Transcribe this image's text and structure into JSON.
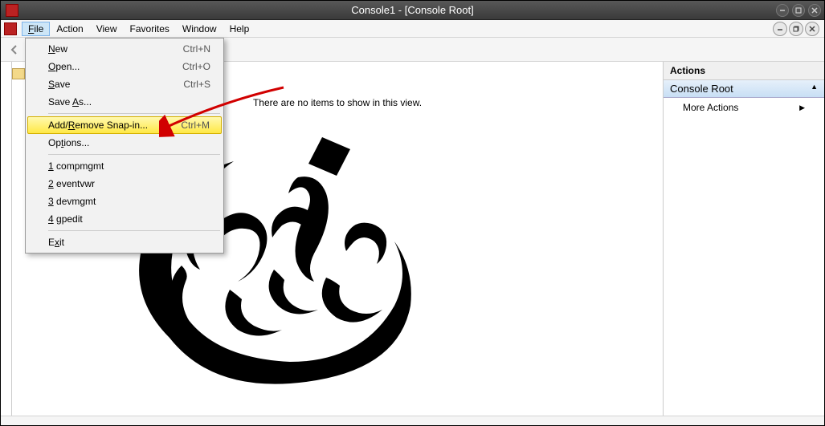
{
  "titlebar": {
    "title": "Console1 - [Console Root]"
  },
  "menubar": {
    "items": [
      "File",
      "Action",
      "View",
      "Favorites",
      "Window",
      "Help"
    ]
  },
  "dropdown": {
    "new": {
      "label": "New",
      "shortcut": "Ctrl+N"
    },
    "open": {
      "label": "Open...",
      "shortcut": "Ctrl+O"
    },
    "save": {
      "label": "Save",
      "shortcut": "Ctrl+S"
    },
    "saveas": {
      "label": "Save As...",
      "shortcut": ""
    },
    "addremove": {
      "label": "Add/Remove Snap-in...",
      "shortcut": "Ctrl+M"
    },
    "options": {
      "label": "Options...",
      "shortcut": ""
    },
    "r1": {
      "label": "1 compmgmt",
      "shortcut": ""
    },
    "r2": {
      "label": "2 eventvwr",
      "shortcut": ""
    },
    "r3": {
      "label": "3 devmgmt",
      "shortcut": ""
    },
    "r4": {
      "label": "4 gpedit",
      "shortcut": ""
    },
    "exit": {
      "label": "Exit",
      "shortcut": ""
    }
  },
  "main": {
    "empty": "There are no items to show in this view."
  },
  "actions": {
    "header": "Actions",
    "group": "Console Root",
    "more": "More Actions"
  }
}
